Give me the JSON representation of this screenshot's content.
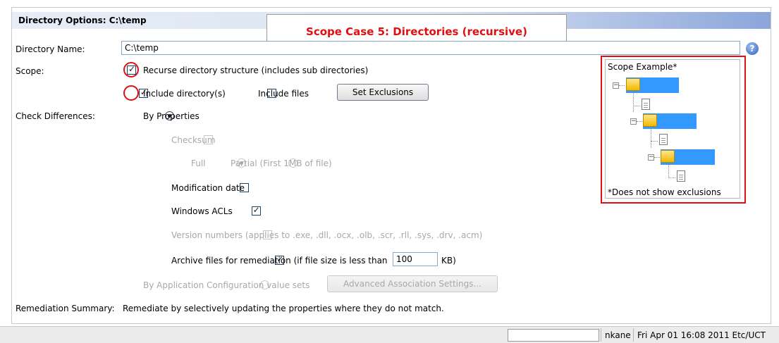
{
  "header": {
    "title": "Directory Options: C:\\temp"
  },
  "annotation": {
    "text": "Scope Case 5: Directories (recursive)"
  },
  "form": {
    "directory_name_label": "Directory Name:",
    "directory_name_value": "C:\\temp",
    "scope_label": "Scope:",
    "recurse_label": "Recurse directory structure (includes sub directories)",
    "recurse_checked": true,
    "include_dirs_label": "Include directory(s)",
    "include_dirs_checked": true,
    "include_files_label": "Include files",
    "include_files_checked": false,
    "set_exclusions_label": "Set Exclusions",
    "check_diff_label": "Check Differences:",
    "by_properties_label": "By Properties",
    "checksum_label": "Checksum",
    "full_label": "Full",
    "partial_label": "Partial (First 1MB of file)",
    "modification_date_label": "Modification date",
    "windows_acls_label": "Windows ACLs",
    "version_numbers_label": "Version numbers (applies to .exe, .dll, .ocx, .olb, .scr, .rll, .sys, .drv, .acm)",
    "archive_label": "Archive files for remediation (if file size is less than",
    "archive_size_value": "100",
    "archive_unit": "KB)",
    "by_app_config_label": "By Application Configuration value sets",
    "advanced_assoc_label": "Advanced Association Settings...",
    "remediation_summary_label": "Remediation Summary:",
    "remediation_summary_text": "Remediate by selectively updating the properties where they do not match."
  },
  "scope_example": {
    "title": "Scope Example*",
    "footnote": "*Does not show exclusions"
  },
  "statusbar": {
    "user": "nkane",
    "datetime": "Fri Apr 01 16:08 2011 Etc/UCT"
  },
  "colors": {
    "accent_red": "#e01010",
    "selection_blue": "#3399ff",
    "header_gradient_end": "#8ca6db"
  },
  "icons": {
    "help": "help-icon",
    "folder": "folder-icon",
    "file": "file-icon",
    "collapse": "collapse-icon"
  }
}
